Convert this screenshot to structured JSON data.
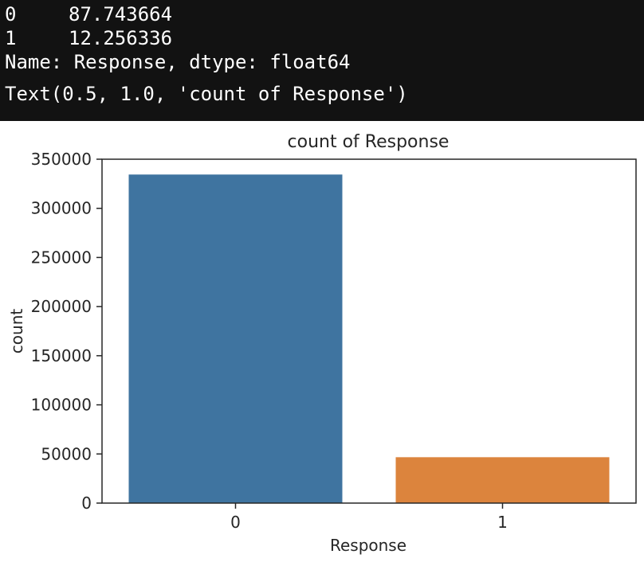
{
  "console_output": {
    "series_rows": [
      {
        "index": "0",
        "value": "87.743664"
      },
      {
        "index": "1",
        "value": "12.256336"
      }
    ],
    "series_meta": "Name: Response, dtype: float64",
    "return_repr": "Text(0.5, 1.0, 'count of Response')"
  },
  "chart_data": {
    "type": "bar",
    "title": "count of Response",
    "xlabel": "Response",
    "ylabel": "count",
    "categories": [
      "0",
      "1"
    ],
    "values": [
      334399,
      46710
    ],
    "colors": [
      "#3f74a0",
      "#dc843d"
    ],
    "ylim": [
      0,
      350000
    ],
    "yticks": [
      0,
      50000,
      100000,
      150000,
      200000,
      250000,
      300000,
      350000
    ],
    "ytick_labels": [
      "0",
      "50000",
      "100000",
      "150000",
      "200000",
      "250000",
      "300000",
      "350000"
    ],
    "grid": false,
    "legend": "none"
  }
}
